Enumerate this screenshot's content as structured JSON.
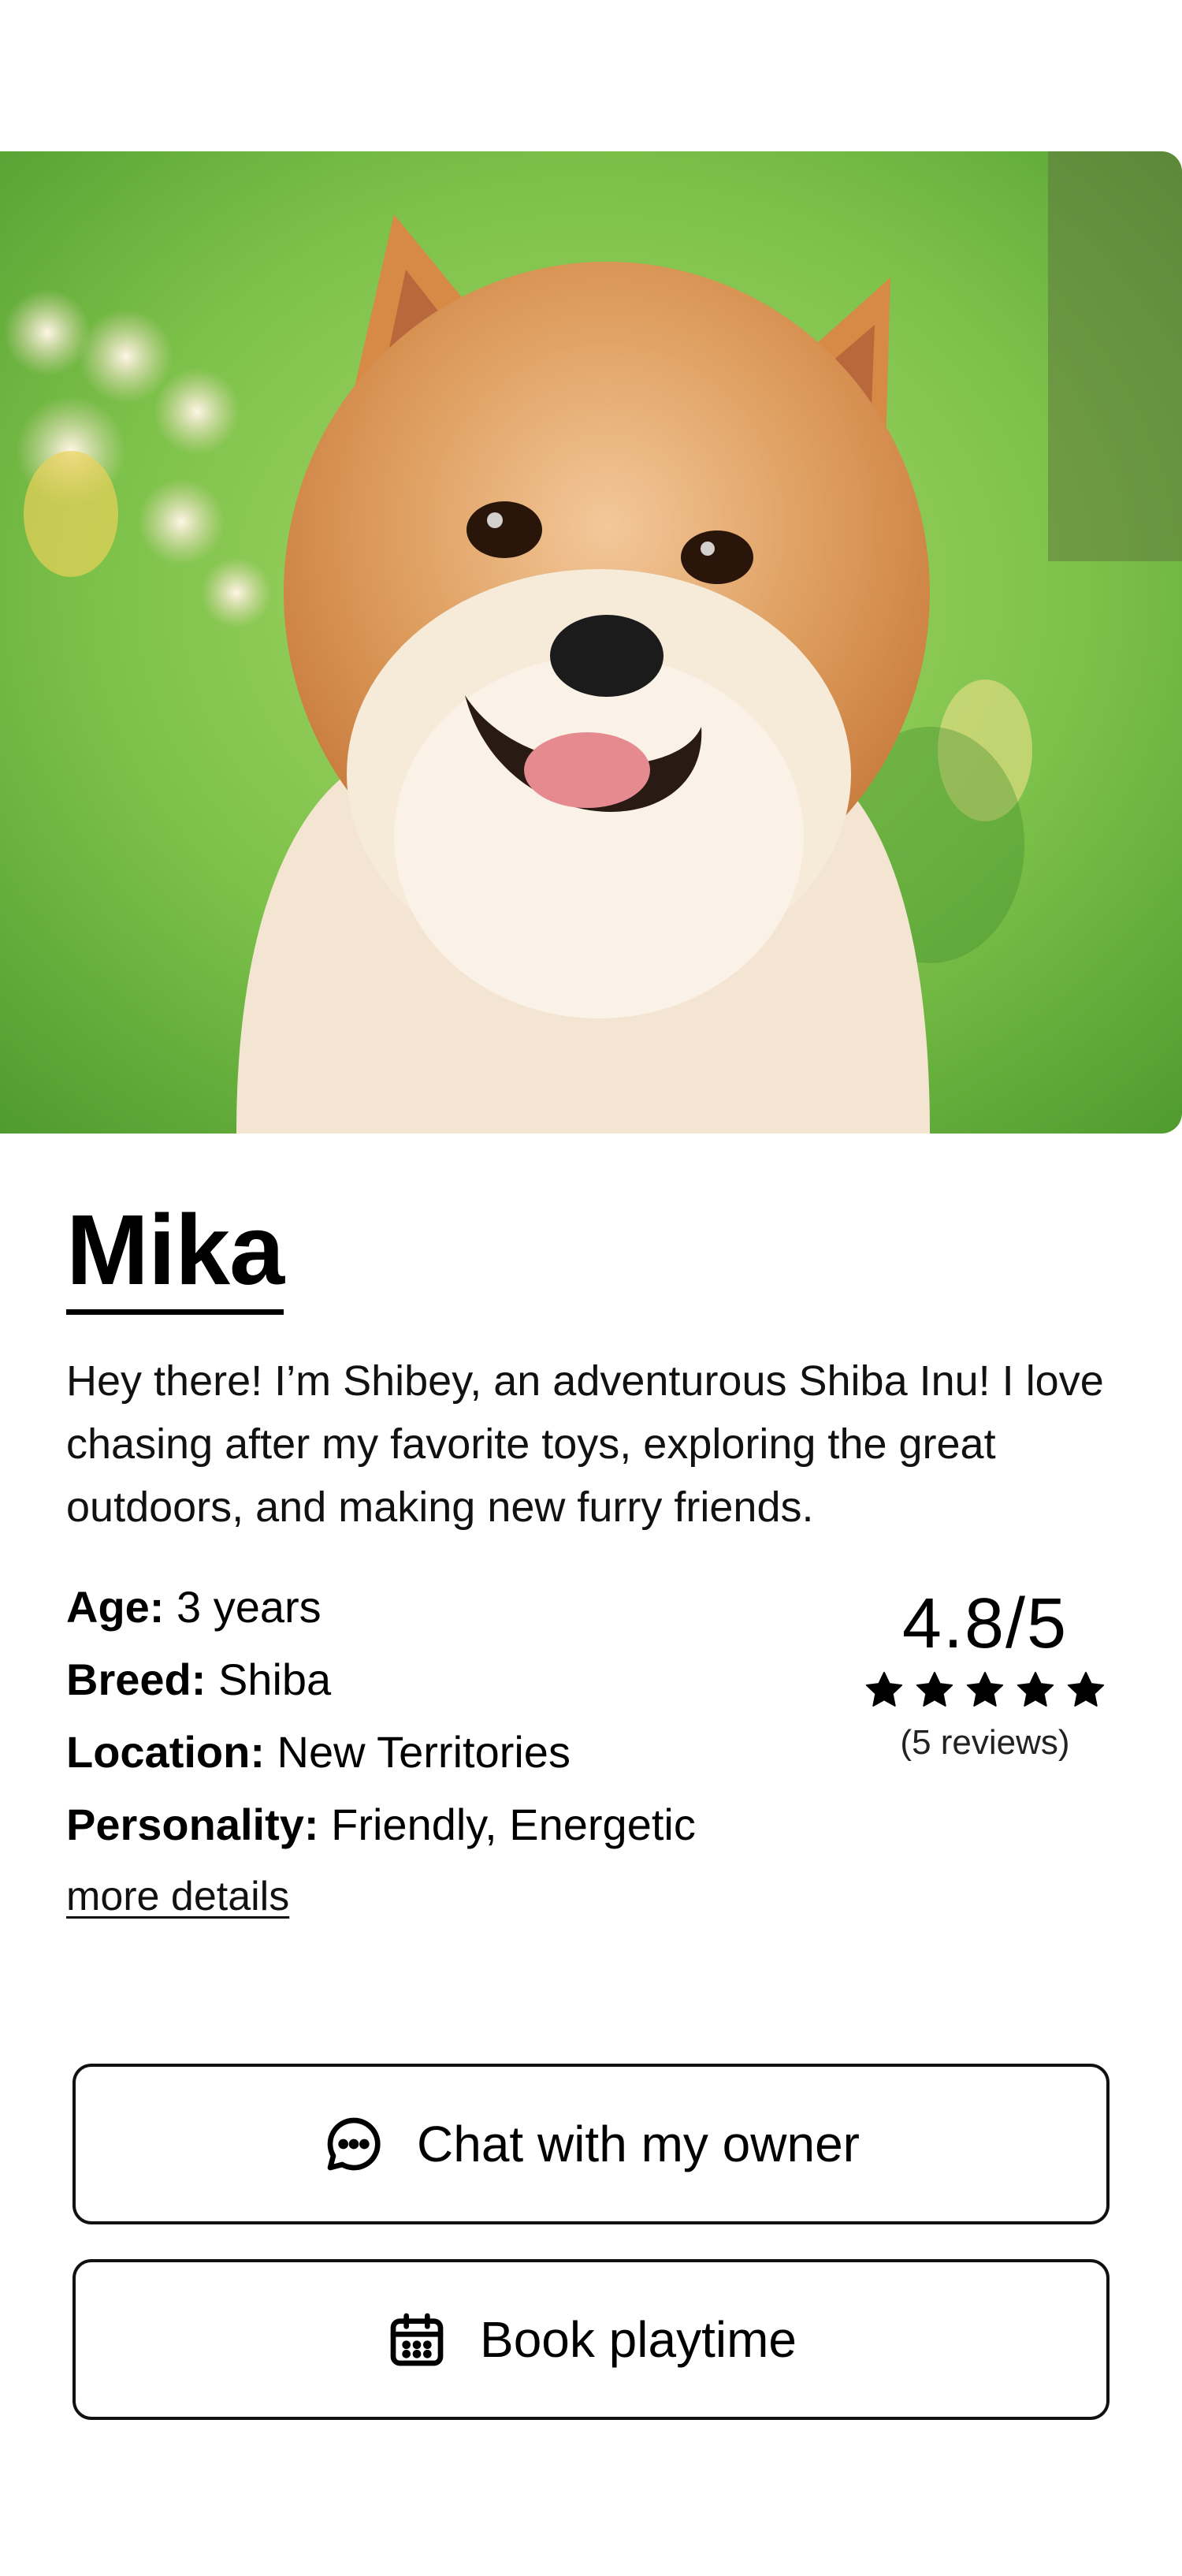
{
  "pet": {
    "name": "Mika",
    "bio": "Hey there! I’m Shibey, an adventurous Shiba Inu! I love chasing after my favorite toys, exploring the great outdoors, and making new furry friends.",
    "photo_icon": "dog-photo"
  },
  "details": [
    {
      "label": "Age:",
      "value": "3 years"
    },
    {
      "label": "Breed:",
      "value": "Shiba"
    },
    {
      "label": "Location:",
      "value": "New Territories"
    },
    {
      "label": "Personality:",
      "value": "Friendly, Energetic"
    }
  ],
  "more_link": "more details",
  "rating": {
    "score_text": "4.8/5",
    "score": 4.8,
    "max": 5,
    "reviews": "(5 reviews)"
  },
  "actions": {
    "chat_label": "Chat with my owner",
    "chat_icon": "chat-bubble-icon",
    "book_label": "Book playtime",
    "book_icon": "calendar-icon"
  },
  "colors": {
    "text": "#000000",
    "border": "#111111",
    "background": "#ffffff"
  }
}
